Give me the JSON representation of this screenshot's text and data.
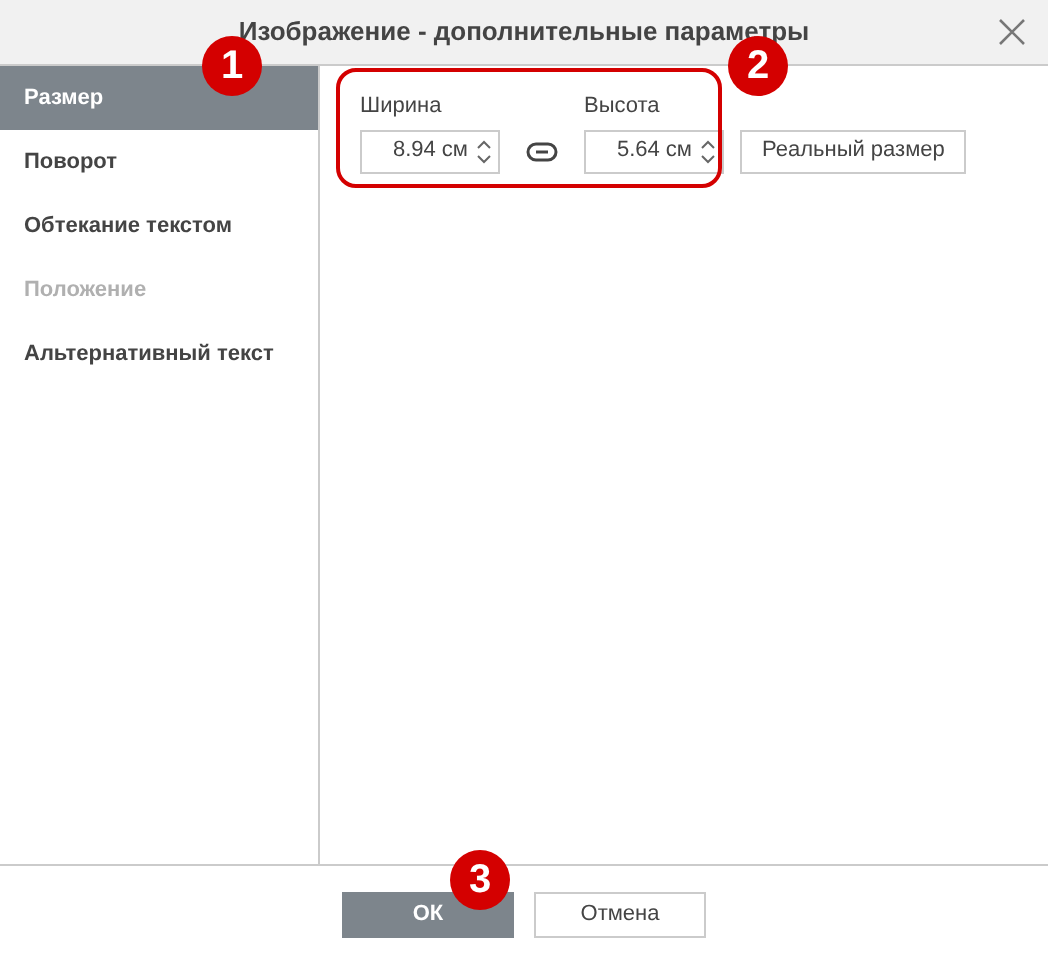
{
  "window": {
    "title": "Изображение - дополнительные параметры"
  },
  "sidebar": {
    "items": [
      {
        "label": "Размер",
        "selected": true,
        "disabled": false
      },
      {
        "label": "Поворот",
        "selected": false,
        "disabled": false
      },
      {
        "label": "Обтекание текстом",
        "selected": false,
        "disabled": false
      },
      {
        "label": "Положение",
        "selected": false,
        "disabled": true
      },
      {
        "label": "Альтернативный текст",
        "selected": false,
        "disabled": false
      }
    ]
  },
  "size": {
    "width": {
      "label": "Ширина",
      "value": "8.94 см"
    },
    "height": {
      "label": "Высота",
      "value": "5.64 см"
    },
    "actual_size_button": "Реальный размер"
  },
  "buttons": [
    {
      "label": "ОК",
      "primary": true
    },
    {
      "label": "Отмена",
      "primary": false
    }
  ],
  "callouts": [
    "1",
    "2",
    "3"
  ]
}
